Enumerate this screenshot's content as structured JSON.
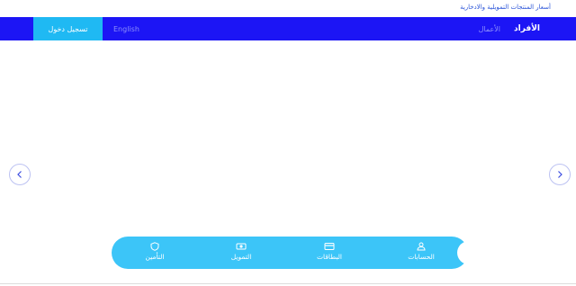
{
  "header": {
    "rates_link": "أسعار المنتجات التمويلية والادخارية"
  },
  "nav": {
    "individuals": "الأفراد",
    "business": "الأعمال",
    "language": "English",
    "login": "تسجيل دخول"
  },
  "colors": {
    "navbar": "#1c15f5",
    "login_button": "#1fb9f3",
    "quick_bar": "#3cc5f8"
  },
  "quick_links": {
    "accounts": "الحسابات",
    "cards": "البطاقات",
    "financing": "التمويل",
    "insurance": "التأمين"
  },
  "icons": {
    "prev": "chevron-left-icon",
    "next": "chevron-right-icon",
    "accounts": "users-icon",
    "cards": "credit-card-icon",
    "financing": "cash-icon",
    "insurance": "shield-icon"
  }
}
